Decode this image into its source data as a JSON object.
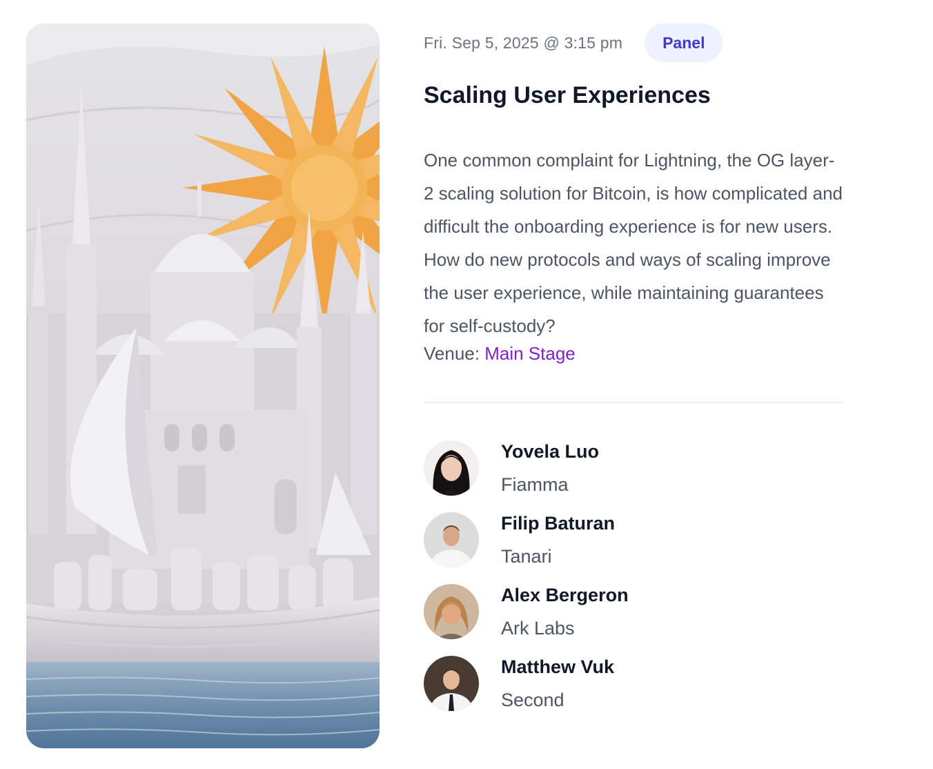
{
  "event": {
    "datetime": "Fri. Sep 5, 2025 @ 3:15 pm",
    "type_badge": "Panel",
    "title": "Scaling User Experiences",
    "description": "One common complaint for Lightning, the OG layer-2 scaling solution for Bitcoin, is how complicated and difficult the onboarding experience is for new users. How do new protocols and ways of scaling improve the user experience, while maintaining guarantees for self-custody?",
    "venue_label": "Venue:",
    "venue_name": "Main Stage"
  },
  "speakers": [
    {
      "name": "Yovela Luo",
      "org": "Fiamma"
    },
    {
      "name": "Filip Baturan",
      "org": "Tanari"
    },
    {
      "name": "Alex Bergeron",
      "org": "Ark Labs"
    },
    {
      "name": "Matthew Vuk",
      "org": "Second"
    }
  ],
  "colors": {
    "badge_bg": "#eef2ff",
    "badge_text": "#4338ca",
    "venue_link": "#7e22ce",
    "sun": "#f2aa4c"
  }
}
